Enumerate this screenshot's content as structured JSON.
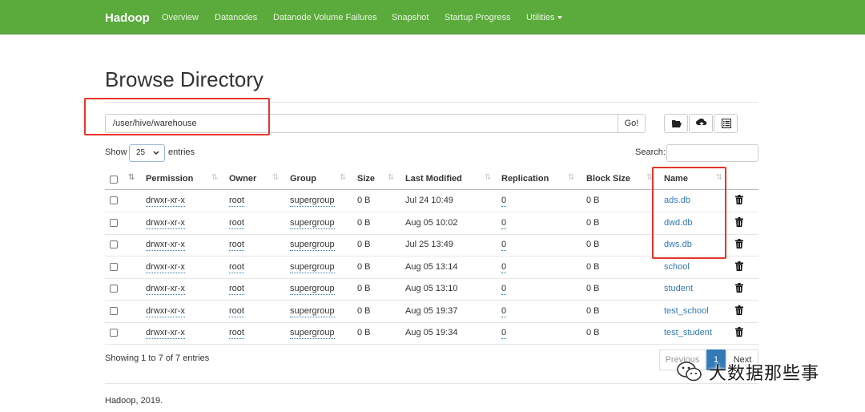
{
  "navbar": {
    "brand": "Hadoop",
    "items": [
      "Overview",
      "Datanodes",
      "Datanode Volume Failures",
      "Snapshot",
      "Startup Progress",
      "Utilities"
    ],
    "bg_color": "#5bab3c"
  },
  "page_title": "Browse Directory",
  "path": {
    "value": "/user/hive/warehouse",
    "go_label": "Go!"
  },
  "toolbar": {
    "icons": [
      "folder-open-icon",
      "upload-icon",
      "list-alt-icon"
    ]
  },
  "length_menu": {
    "show_label": "Show",
    "selected": "25",
    "entries_label": "entries"
  },
  "search": {
    "label": "Search:",
    "value": ""
  },
  "table": {
    "columns": [
      "Permission",
      "Owner",
      "Group",
      "Size",
      "Last Modified",
      "Replication",
      "Block Size",
      "Name"
    ],
    "rows": [
      {
        "permission": "drwxr-xr-x",
        "owner": "root",
        "group": "supergroup",
        "size": "0 B",
        "modified": "Jul 24 10:49",
        "replication": "0",
        "block_size": "0 B",
        "name": "ads.db"
      },
      {
        "permission": "drwxr-xr-x",
        "owner": "root",
        "group": "supergroup",
        "size": "0 B",
        "modified": "Aug 05 10:02",
        "replication": "0",
        "block_size": "0 B",
        "name": "dwd.db"
      },
      {
        "permission": "drwxr-xr-x",
        "owner": "root",
        "group": "supergroup",
        "size": "0 B",
        "modified": "Jul 25 13:49",
        "replication": "0",
        "block_size": "0 B",
        "name": "dws.db"
      },
      {
        "permission": "drwxr-xr-x",
        "owner": "root",
        "group": "supergroup",
        "size": "0 B",
        "modified": "Aug 05 13:14",
        "replication": "0",
        "block_size": "0 B",
        "name": "school"
      },
      {
        "permission": "drwxr-xr-x",
        "owner": "root",
        "group": "supergroup",
        "size": "0 B",
        "modified": "Aug 05 13:10",
        "replication": "0",
        "block_size": "0 B",
        "name": "student"
      },
      {
        "permission": "drwxr-xr-x",
        "owner": "root",
        "group": "supergroup",
        "size": "0 B",
        "modified": "Aug 05 19:37",
        "replication": "0",
        "block_size": "0 B",
        "name": "test_school"
      },
      {
        "permission": "drwxr-xr-x",
        "owner": "root",
        "group": "supergroup",
        "size": "0 B",
        "modified": "Aug 05 19:34",
        "replication": "0",
        "block_size": "0 B",
        "name": "test_student"
      }
    ]
  },
  "info": "Showing 1 to 7 of 7 entries",
  "pagination": {
    "previous": "Previous",
    "current": "1",
    "next": "Next"
  },
  "footer": "Hadoop, 2019.",
  "watermark": "大数据那些事",
  "colors": {
    "link": "#337ab7",
    "highlight_box": "#e8332a"
  }
}
